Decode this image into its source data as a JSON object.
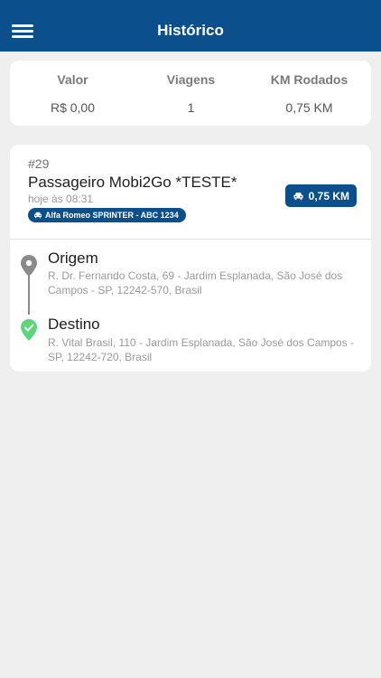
{
  "header": {
    "title": "Histórico"
  },
  "summary": {
    "valor_label": "Valor",
    "valor": "R$ 0,00",
    "viagens_label": "Viagens",
    "viagens": "1",
    "km_label": "KM Rodados",
    "km": "0,75 KM"
  },
  "trip": {
    "id": "#29",
    "passenger": "Passageiro Mobi2Go *TESTE*",
    "time": "hoje às 08:31",
    "vehicle": "Alfa Romeo SPRINTER - ABC 1234",
    "distance": "0,75 KM",
    "origin": {
      "label": "Origem",
      "address": "R. Dr. Fernando Costa, 69 - Jardim Esplanada, São José dos Campos - SP, 12242-570, Brasil"
    },
    "destination": {
      "label": "Destino",
      "address": "R. Vital Brasil, 110 - Jardim Esplanada, São José dos Campos - SP, 12242-720, Brasil"
    }
  },
  "colors": {
    "header_bg": "#0b4f8c",
    "badge_bg": "#0b4f8c",
    "origin_pin": "#8a8a8a",
    "destination_pin": "#5bd67a",
    "background": "#efefef"
  },
  "icons": {
    "menu": "hamburger-menu-icon",
    "vehicle": "car-icon",
    "origin": "map-pin-icon",
    "destination": "check-pin-icon"
  }
}
